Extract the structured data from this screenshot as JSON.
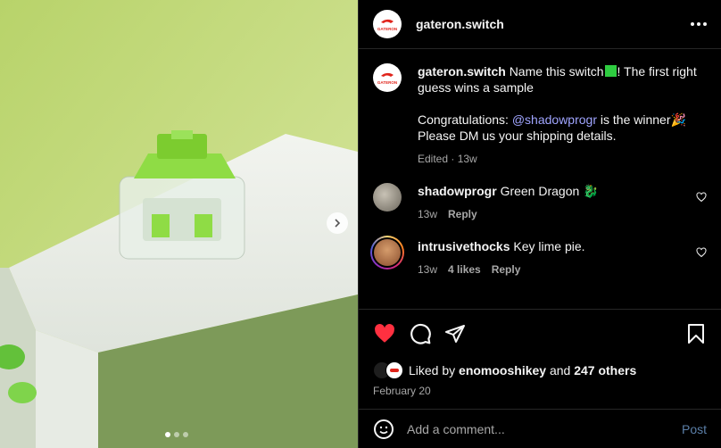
{
  "post": {
    "username": "gateron.switch",
    "logo_text": "GATERON",
    "carousel_dots": 3,
    "caption_text": "Name this switch",
    "caption_rest": "! The first right guess wins a sample",
    "congrats_pre": "Congratulations: ",
    "mention": "@shadowprogr",
    "congrats_post": " is the winner",
    "dm_line": "Please DM us your shipping details.",
    "edited": "Edited · 13w"
  },
  "comments": [
    {
      "username": "shadowprogr",
      "text": "Green Dragon",
      "emoji": "🐉",
      "age": "13w",
      "likes": "",
      "reply": "Reply"
    },
    {
      "username": "intrusivethocks",
      "text": "Key lime pie.",
      "age": "13w",
      "likes": "4 likes",
      "reply": "Reply"
    }
  ],
  "likes_line": {
    "prefix": "Liked by ",
    "user": "enomooshikey",
    "middle": " and ",
    "others": "247 others"
  },
  "date": "February 20",
  "add_comment": {
    "placeholder": "Add a comment...",
    "post_label": "Post"
  },
  "colors": {
    "liked_heart": "#ff3040",
    "mention": "#a0a5ff",
    "post_button": "#5b7fa8",
    "caption_emoji": "#2ecc40"
  },
  "icons": [
    "more-icon",
    "like-icon",
    "comment-icon",
    "share-icon",
    "bookmark-icon",
    "emoji-icon",
    "next-icon",
    "heart-small-icon"
  ]
}
